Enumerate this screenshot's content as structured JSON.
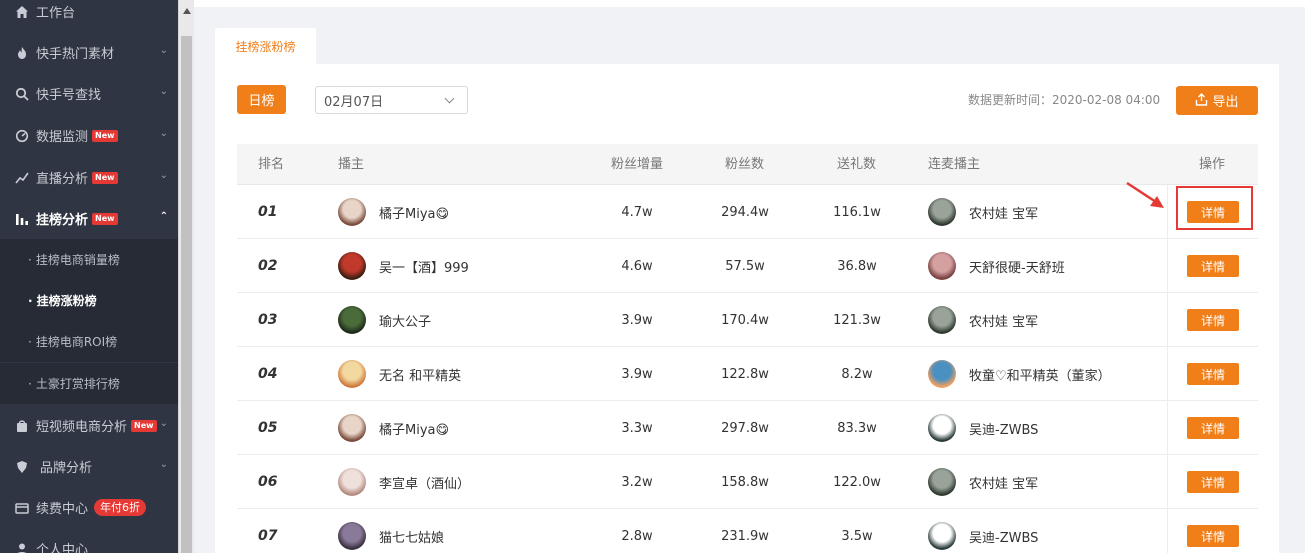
{
  "sidebar": {
    "items": [
      {
        "label": "工作台",
        "icon": "home-icon"
      },
      {
        "label": "快手热门素材",
        "icon": "fire-icon"
      },
      {
        "label": "快手号查找",
        "icon": "search-icon"
      },
      {
        "label": "数据监测",
        "icon": "monitor-icon",
        "badge": "New"
      },
      {
        "label": "直播分析",
        "icon": "live-chart-icon",
        "badge": "New"
      },
      {
        "label": "挂榜分析",
        "icon": "bar-chart-icon",
        "badge": "New"
      },
      {
        "label": "短视频电商分析",
        "icon": "shopping-bag-icon",
        "badge": "New"
      },
      {
        "label": "品牌分析",
        "icon": "brand-shield-icon"
      },
      {
        "label": "续费中心",
        "icon": "wallet-icon",
        "pill": "年付6折"
      },
      {
        "label": "个人中心",
        "icon": "user-icon"
      }
    ],
    "submenu": [
      {
        "label": "挂榜电商销量榜"
      },
      {
        "label": "挂榜涨粉榜"
      },
      {
        "label": "挂榜电商ROI榜"
      },
      {
        "label": "土豪打赏排行榜"
      }
    ]
  },
  "tab": {
    "label": "挂榜涨粉榜"
  },
  "toolbar": {
    "day_label": "日榜",
    "date_value": "02月07日",
    "update_time": "数据更新时间：2020-02-08 04:00",
    "export_label": "导出"
  },
  "table": {
    "headers": [
      "排名",
      "播主",
      "粉丝增量",
      "粉丝数",
      "送礼数",
      "连麦播主",
      "操作"
    ],
    "detail_label": "详情",
    "rows": [
      {
        "rank": "01",
        "host": "橘子Miya😋",
        "fan_gain": "4.7w",
        "fans": "294.4w",
        "gifts": "116.1w",
        "co_host": "农村娃 宝军"
      },
      {
        "rank": "02",
        "host": "吴一【酒】999",
        "fan_gain": "4.6w",
        "fans": "57.5w",
        "gifts": "36.8w",
        "co_host": "天舒很硬-天舒班"
      },
      {
        "rank": "03",
        "host": "瑜大公子",
        "fan_gain": "3.9w",
        "fans": "170.4w",
        "gifts": "121.3w",
        "co_host": "农村娃 宝军"
      },
      {
        "rank": "04",
        "host": "无名 和平精英",
        "fan_gain": "3.9w",
        "fans": "122.8w",
        "gifts": "8.2w",
        "co_host": "牧童♡和平精英（董家）"
      },
      {
        "rank": "05",
        "host": "橘子Miya😋",
        "fan_gain": "3.3w",
        "fans": "297.8w",
        "gifts": "83.3w",
        "co_host": "吴迪-ZWBS"
      },
      {
        "rank": "06",
        "host": "李宣卓（酒仙）",
        "fan_gain": "3.2w",
        "fans": "158.8w",
        "gifts": "122.0w",
        "co_host": "农村娃 宝军"
      },
      {
        "rank": "07",
        "host": "猫七七姑娘",
        "fan_gain": "2.8w",
        "fans": "231.9w",
        "gifts": "3.5w",
        "co_host": "吴迪-ZWBS"
      }
    ]
  },
  "colors": {
    "accent": "#f07f1a",
    "sidebar_bg": "#2f3542",
    "annotation": "#e53935"
  }
}
